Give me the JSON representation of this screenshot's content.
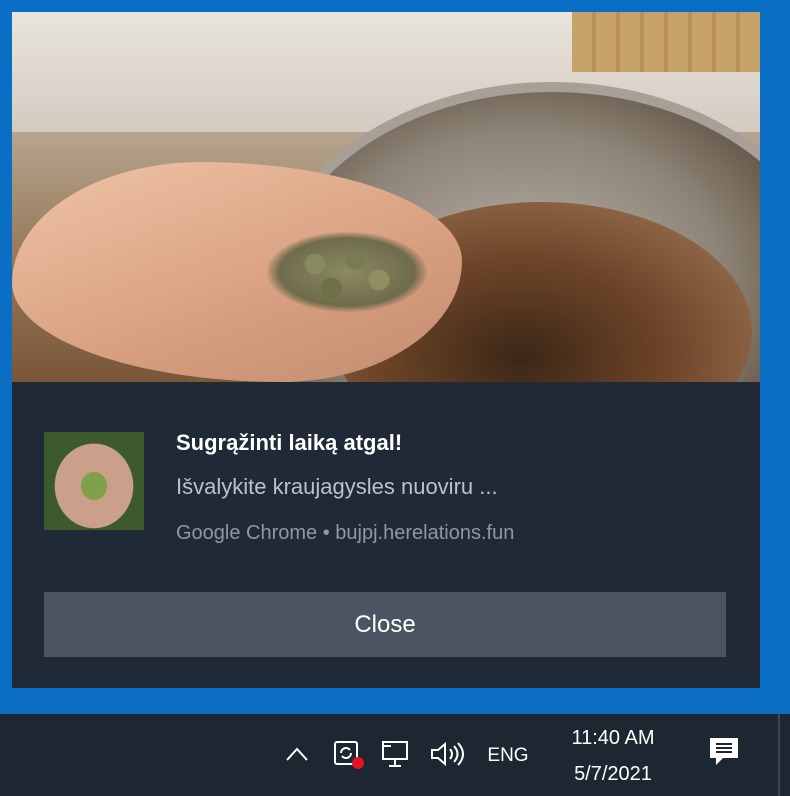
{
  "notification": {
    "title": "Sugrąžinti laiką atgal!",
    "message": "Išvalykite kraujagysles nuoviru ...",
    "attribution": "Google Chrome • bujpj.herelations.fun",
    "close_label": "Close"
  },
  "taskbar": {
    "language": "ENG",
    "time": "11:40 AM",
    "date": "5/7/2021",
    "icons": [
      "chevron-up-icon",
      "security-alert-icon",
      "network-icon",
      "volume-icon",
      "action-center-icon"
    ]
  },
  "colors": {
    "desktop_frame": "#0a6fc4",
    "toast_background": "#1f2a36",
    "close_button": "#4a5561",
    "alert_dot": "#e81123"
  }
}
